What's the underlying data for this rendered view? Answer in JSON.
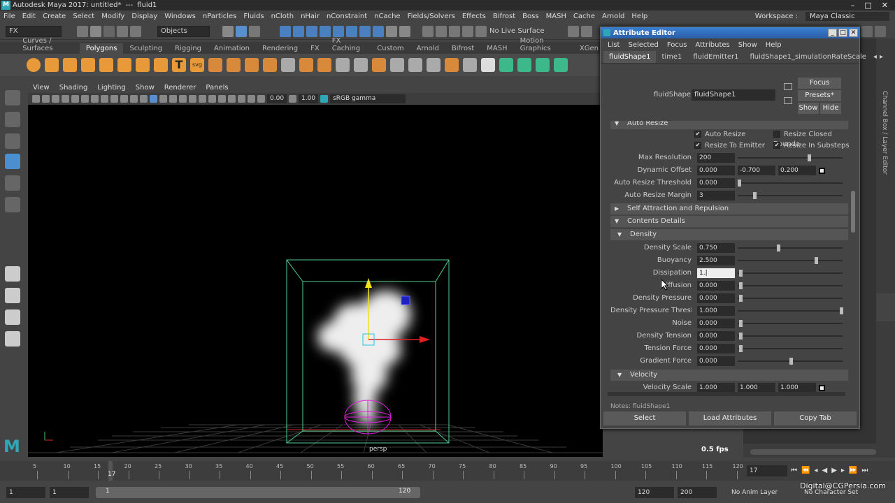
{
  "title": {
    "app": "Autodesk Maya 2017: untitled*",
    "sep": "---",
    "node": "fluid1"
  },
  "menu": [
    "File",
    "Edit",
    "Create",
    "Select",
    "Modify",
    "Display",
    "Windows",
    "nParticles",
    "Fluids",
    "nCloth",
    "nHair",
    "nConstraint",
    "nCache",
    "Fields/Solvers",
    "Effects",
    "Bifrost",
    "Boss",
    "MASH",
    "Cache",
    "Arnold",
    "Help"
  ],
  "workspace": {
    "label": "Workspace :",
    "value": "Maya Classic"
  },
  "status": {
    "mode": "FX",
    "objects": "Objects",
    "live": "No Live Surface"
  },
  "shelf_tabs": [
    "Curves / Surfaces",
    "Polygons",
    "Sculpting",
    "Rigging",
    "Animation",
    "Rendering",
    "FX",
    "FX Caching",
    "Custom",
    "Arnold",
    "Bifrost",
    "MASH",
    "Motion Graphics",
    "XGen"
  ],
  "viewport": {
    "menu": [
      "View",
      "Shading",
      "Lighting",
      "Show",
      "Renderer",
      "Panels"
    ],
    "field1": "0.00",
    "field2": "1.00",
    "colorspace": "sRGB gamma",
    "camera": "persp",
    "fps": "0.5 fps"
  },
  "ae": {
    "title": "Attribute Editor",
    "menu": [
      "List",
      "Selected",
      "Focus",
      "Attributes",
      "Show",
      "Help"
    ],
    "tabs": [
      "fluidShape1",
      "time1",
      "fluidEmitter1",
      "fluidShape1_simulationRateScale"
    ],
    "shape_label": "fluidShape:",
    "shape_value": "fluidShape1",
    "focus": "Focus",
    "presets": "Presets*",
    "show": "Show",
    "hide": "Hide",
    "section_auto": "Auto Resize",
    "chk": {
      "auto_resize": "Auto Resize",
      "resize_closed": "Resize Closed Bounda",
      "resize_emitter": "Resize To Emitter",
      "resize_substeps": "Resize In Substeps"
    },
    "max_res": {
      "label": "Max Resolution",
      "value": "200"
    },
    "dyn_off": {
      "label": "Dynamic Offset",
      "x": "0.000",
      "y": "-0.700",
      "z": "0.200"
    },
    "ar_thresh": {
      "label": "Auto Resize Threshold",
      "value": "0.000"
    },
    "ar_margin": {
      "label": "Auto Resize Margin",
      "value": "3"
    },
    "section_self": "Self Attraction and Repulsion",
    "section_contents": "Contents Details",
    "section_density": "Density",
    "density_rows": [
      {
        "label": "Density Scale",
        "value": "0.750"
      },
      {
        "label": "Buoyancy",
        "value": "2.500"
      },
      {
        "label": "Dissipation",
        "value": "1.|"
      },
      {
        "label": "Diffusion",
        "value": "0.000"
      },
      {
        "label": "Density Pressure",
        "value": "0.000"
      },
      {
        "label": "Density Pressure Threshold",
        "value": "1.000"
      },
      {
        "label": "Noise",
        "value": "0.000"
      },
      {
        "label": "Density Tension",
        "value": "0.000"
      },
      {
        "label": "Tension Force",
        "value": "0.000"
      },
      {
        "label": "Gradient Force",
        "value": "0.000"
      }
    ],
    "section_velocity": "Velocity",
    "vel_scale": {
      "label": "Velocity Scale",
      "x": "1.000",
      "y": "1.000",
      "z": "1.000"
    },
    "notes": "Notes: fluidShape1",
    "btn_select": "Select",
    "btn_load": "Load Attributes",
    "btn_copy": "Copy Tab"
  },
  "side_label": "Channel Box / Layer Editor",
  "timeline": {
    "ticks": [
      "5",
      "10",
      "15",
      "20",
      "25",
      "30",
      "35",
      "40",
      "45",
      "50",
      "55",
      "60",
      "65",
      "70",
      "75",
      "80",
      "85",
      "90",
      "95",
      "100",
      "105",
      "110",
      "115",
      "120"
    ],
    "current": "17",
    "frame_field": "17"
  },
  "range": {
    "start": "1",
    "start2": "1",
    "bar_start": "1",
    "bar_end": "120",
    "end": "120",
    "end2": "200",
    "anim_layer": "No Anim Layer",
    "char_set": "No Character Set"
  },
  "watermark": "Digital@CGPersia.com"
}
